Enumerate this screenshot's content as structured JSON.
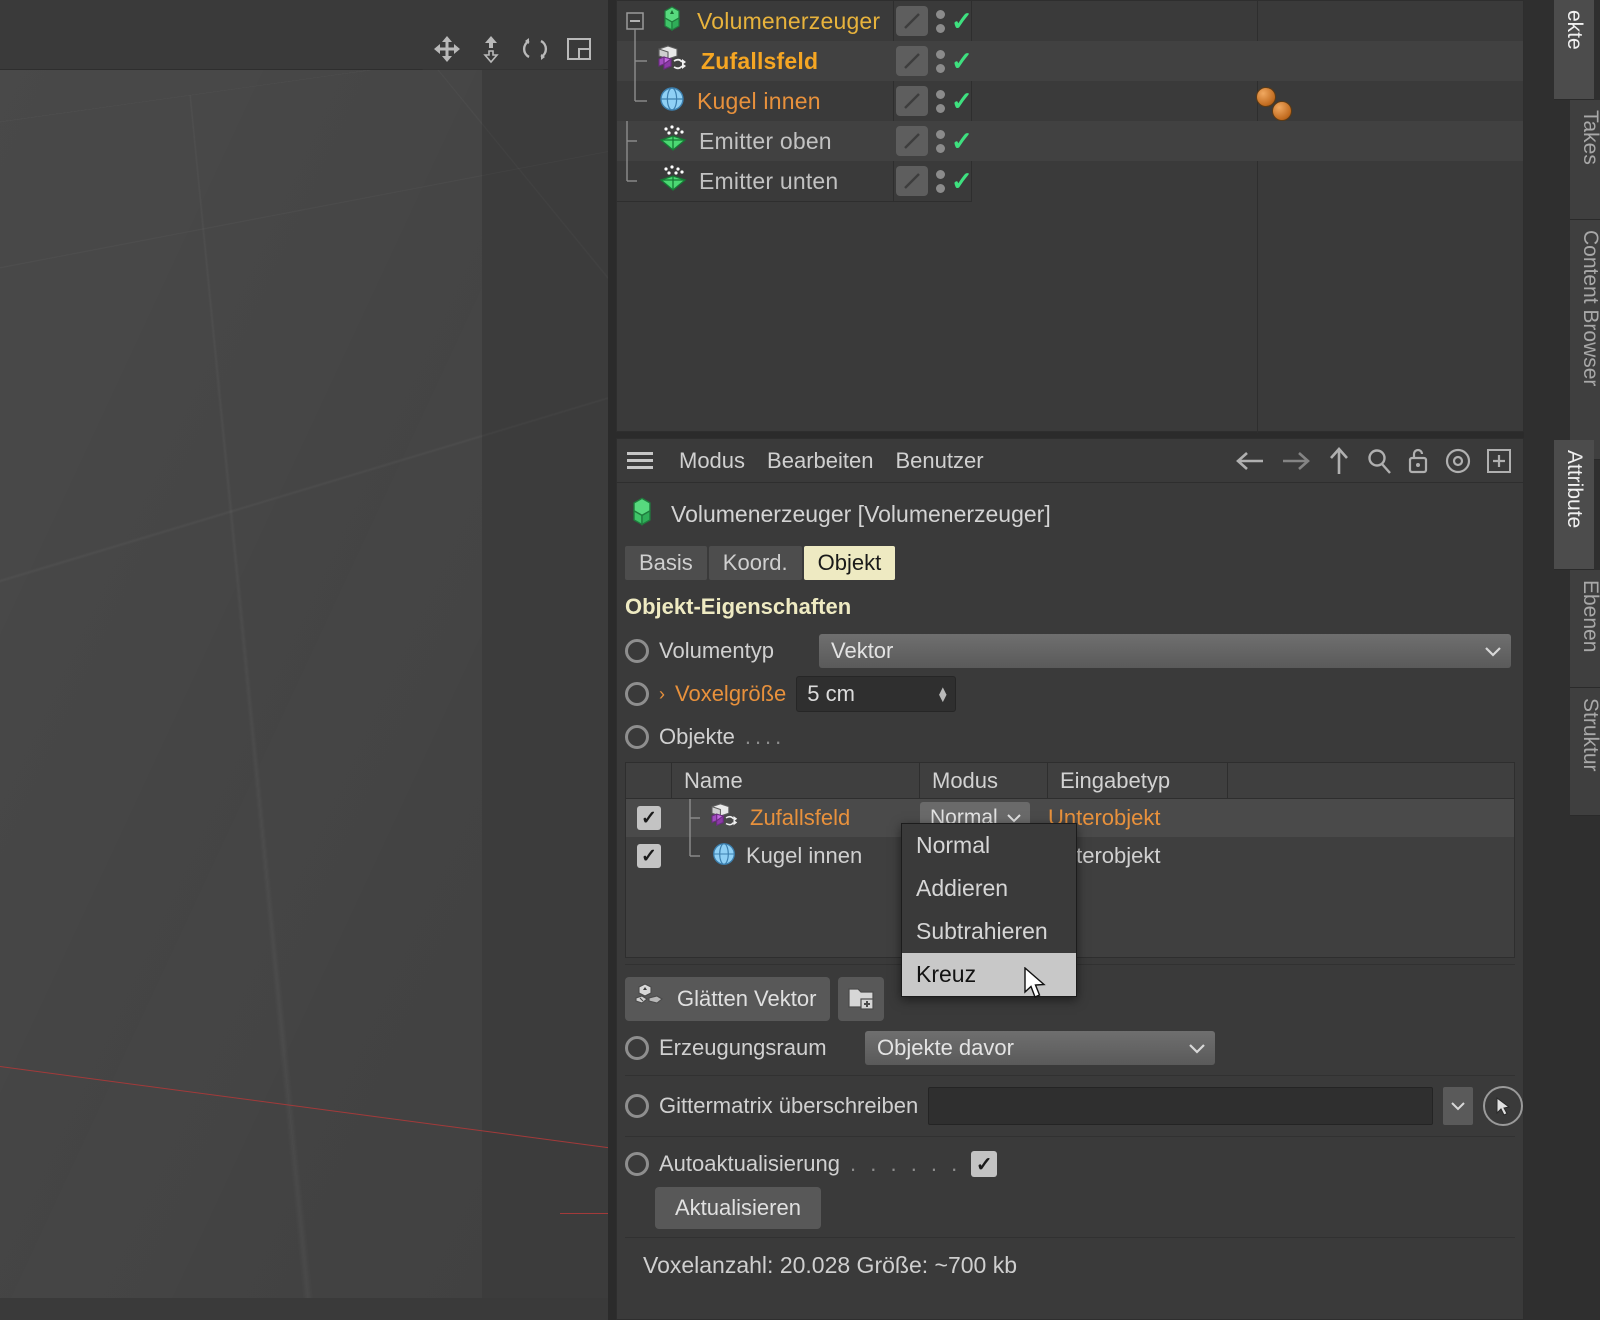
{
  "viewport": {
    "tools": [
      {
        "name": "move-tool",
        "label": "Verschieben"
      },
      {
        "name": "scale-tool",
        "label": "Skalieren"
      },
      {
        "name": "rotate-tool",
        "label": "Drehen"
      },
      {
        "name": "layout-tool",
        "label": "Ansicht"
      }
    ]
  },
  "object_manager": {
    "rows": [
      {
        "label": "Volumenerzeuger",
        "icon": "volume-generator-icon",
        "style": "yellow",
        "indent": 0,
        "expander": "minus",
        "tags": []
      },
      {
        "label": "Zufallsfeld",
        "icon": "random-field-icon",
        "style": "orange-bold",
        "indent": 1,
        "expander": "none",
        "tags": []
      },
      {
        "label": "Kugel innen",
        "icon": "sphere-icon",
        "style": "orange",
        "indent": 1,
        "expander": "none",
        "tags": [
          "material-tag",
          "material-tag"
        ]
      },
      {
        "label": "Emitter oben",
        "icon": "emitter-icon",
        "style": "grey",
        "indent": 0,
        "expander": "none",
        "tags": []
      },
      {
        "label": "Emitter unten",
        "icon": "emitter-icon",
        "style": "grey",
        "indent": 0,
        "expander": "none",
        "tags": []
      }
    ]
  },
  "attribute_manager": {
    "menu": [
      "Modus",
      "Bearbeiten",
      "Benutzer"
    ],
    "toolbar_icons": [
      "back-arrow-icon",
      "forward-arrow-icon",
      "up-arrow-icon",
      "search-icon",
      "lock-icon",
      "target-icon",
      "add-panel-icon"
    ],
    "object_title": "Volumenerzeuger [Volumenerzeuger]",
    "tabs": [
      {
        "label": "Basis",
        "active": false
      },
      {
        "label": "Koord.",
        "active": false
      },
      {
        "label": "Objekt",
        "active": true
      }
    ],
    "section_title": "Objekt-Eigenschaften",
    "volumentyp": {
      "label": "Volumentyp",
      "value": "Vektor"
    },
    "voxelgroesse": {
      "label": "Voxelgröße",
      "value": "5 cm"
    },
    "objekte": {
      "label": "Objekte",
      "dots": "...."
    },
    "table": {
      "headers": [
        "",
        "Name",
        "Modus",
        "Eingabetyp",
        ""
      ],
      "rows": [
        {
          "checked": true,
          "name": "Zufallsfeld",
          "icon": "random-field-icon",
          "name_style": "orange",
          "mode": "Normal",
          "type": "Unterobjekt",
          "type_style": "orange",
          "selected": true
        },
        {
          "checked": true,
          "name": "Kugel innen",
          "icon": "sphere-icon",
          "name_style": "grey",
          "mode": "Normal",
          "type": "Unterobjekt",
          "type_style": "grey",
          "selected": false
        }
      ]
    },
    "mode_dropdown_open": {
      "options": [
        "Normal",
        "Addieren",
        "Subtrahieren",
        "Kreuz"
      ],
      "highlighted": "Kreuz"
    },
    "smooth": {
      "label": "Glätten Vektor",
      "icon": "smooth-vector-icon",
      "add_icon": "add-folder-icon"
    },
    "erzeugungsraum": {
      "label": "Erzeugungsraum",
      "value": "Objekte davor"
    },
    "gittermatrix": {
      "label": "Gittermatrix überschreiben",
      "value": ""
    },
    "autoaktualisierung": {
      "label": "Autoaktualisierung",
      "dots": ". . . . . .",
      "checked": true
    },
    "update_button": "Aktualisieren",
    "status": "Voxelanzahl: 20.028   Größe: ~700 kb"
  },
  "sidebar": {
    "group_top": [
      {
        "label": "ekte",
        "active": true
      },
      {
        "label": "Takes",
        "active": false
      },
      {
        "label": "Content Browser",
        "active": false
      }
    ],
    "group_bottom": [
      {
        "label": "Attribute",
        "active": true
      },
      {
        "label": "Ebenen",
        "active": false
      },
      {
        "label": "Struktur",
        "active": false
      }
    ]
  },
  "colors": {
    "accent_orange": "#e8913c",
    "accent_yellow": "#e8b33c",
    "tab_active": "#eeeac2",
    "check_green": "#3ee07f",
    "panel_bg": "#3a3a3a"
  }
}
